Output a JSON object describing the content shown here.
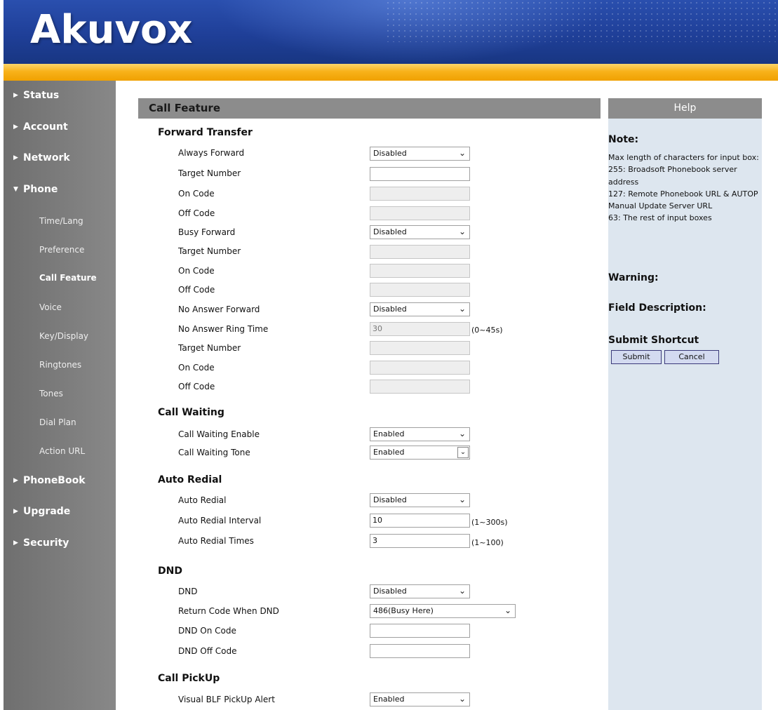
{
  "header": {
    "logo_text": "Akuvox"
  },
  "sidebar": {
    "items": [
      {
        "label": "Status",
        "arrow": "▶"
      },
      {
        "label": "Account",
        "arrow": "▶"
      },
      {
        "label": "Network",
        "arrow": "▶"
      },
      {
        "label": "Phone",
        "arrow": "▼"
      },
      {
        "label": "PhoneBook",
        "arrow": "▶"
      },
      {
        "label": "Upgrade",
        "arrow": "▶"
      },
      {
        "label": "Security",
        "arrow": "▶"
      }
    ],
    "phone_subitems": [
      "Time/Lang",
      "Preference",
      "Call Feature",
      "Voice",
      "Key/Display",
      "Ringtones",
      "Tones",
      "Dial Plan",
      "Action URL"
    ],
    "active_subitem": "Call Feature"
  },
  "main": {
    "title": "Call Feature",
    "sections": {
      "forward_transfer": "Forward Transfer",
      "call_waiting": "Call Waiting",
      "auto_redial": "Auto Redial",
      "dnd": "DND",
      "call_pickup": "Call PickUp"
    },
    "fields": {
      "always_forward": {
        "label": "Always Forward",
        "value": "Disabled"
      },
      "af_target_number": {
        "label": "Target Number",
        "value": ""
      },
      "af_on_code": {
        "label": "On Code",
        "value": ""
      },
      "af_off_code": {
        "label": "Off Code",
        "value": ""
      },
      "busy_forward": {
        "label": "Busy Forward",
        "value": "Disabled"
      },
      "bf_target_number": {
        "label": "Target Number",
        "value": ""
      },
      "bf_on_code": {
        "label": "On Code",
        "value": ""
      },
      "bf_off_code": {
        "label": "Off Code",
        "value": ""
      },
      "no_answer_forward": {
        "label": "No Answer Forward",
        "value": "Disabled"
      },
      "no_answer_ring_time": {
        "label": "No Answer Ring Time",
        "value": "30",
        "hint": "(0~45s)"
      },
      "na_target_number": {
        "label": "Target Number",
        "value": ""
      },
      "na_on_code": {
        "label": "On Code",
        "value": ""
      },
      "na_off_code": {
        "label": "Off Code",
        "value": ""
      },
      "call_waiting_enable": {
        "label": "Call Waiting Enable",
        "value": "Enabled"
      },
      "call_waiting_tone": {
        "label": "Call Waiting Tone",
        "value": "Enabled"
      },
      "auto_redial": {
        "label": "Auto Redial",
        "value": "Disabled"
      },
      "auto_redial_interval": {
        "label": "Auto Redial Interval",
        "value": "10",
        "hint": "(1~300s)"
      },
      "auto_redial_times": {
        "label": "Auto Redial Times",
        "value": "3",
        "hint": "(1~100)"
      },
      "dnd": {
        "label": "DND",
        "value": "Disabled"
      },
      "return_code_when_dnd": {
        "label": "Return Code When DND",
        "value": "486(Busy Here)"
      },
      "dnd_on_code": {
        "label": "DND On Code",
        "value": ""
      },
      "dnd_off_code": {
        "label": "DND Off Code",
        "value": ""
      },
      "visual_blf_pickup_alert": {
        "label": "Visual BLF PickUp Alert",
        "value": "Enabled"
      }
    }
  },
  "help": {
    "title": "Help",
    "note_heading": "Note:",
    "note_lines": [
      "Max length of characters for input box:",
      "255: Broadsoft Phonebook server address",
      "127: Remote Phonebook URL & AUTOP Manual Update Server URL",
      "63: The rest of input boxes"
    ],
    "warning_heading": "Warning:",
    "field_description_heading": "Field Description:",
    "submit_shortcut_heading": "Submit Shortcut",
    "submit_label": "Submit",
    "cancel_label": "Cancel"
  },
  "icons": {
    "expand": "triangle-right-icon",
    "collapse": "triangle-down-icon",
    "dropdown": "chevron-down-icon"
  }
}
